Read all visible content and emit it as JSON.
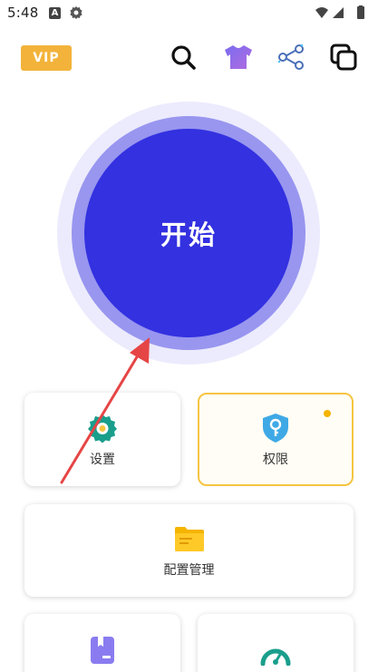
{
  "status_bar": {
    "time": "5:48",
    "a_badge": "A"
  },
  "top_bar": {
    "vip_label": "VIP",
    "icons": [
      "search-icon",
      "tshirt-icon",
      "share-icon",
      "copy-icon"
    ]
  },
  "start_button": {
    "label": "开始"
  },
  "cards": {
    "settings": {
      "label": "设置",
      "icon": "gear-icon"
    },
    "permissions": {
      "label": "权限",
      "icon": "shield-key-icon",
      "has_notification_dot": true
    },
    "config_management": {
      "label": "配置管理",
      "icon": "folder-icon"
    },
    "bottom_left": {
      "icon": "bookmark-icon"
    },
    "bottom_right": {
      "icon": "speedometer-icon"
    }
  },
  "colors": {
    "accent": "#3331e0",
    "accent_ring": "#9896ef",
    "accent_halo": "#ecebfd",
    "vip": "#f3b33a",
    "highlight_border": "#f5c542",
    "teal": "#1a9e8c",
    "folder": "#f5b400",
    "arrow": "#e64545"
  }
}
